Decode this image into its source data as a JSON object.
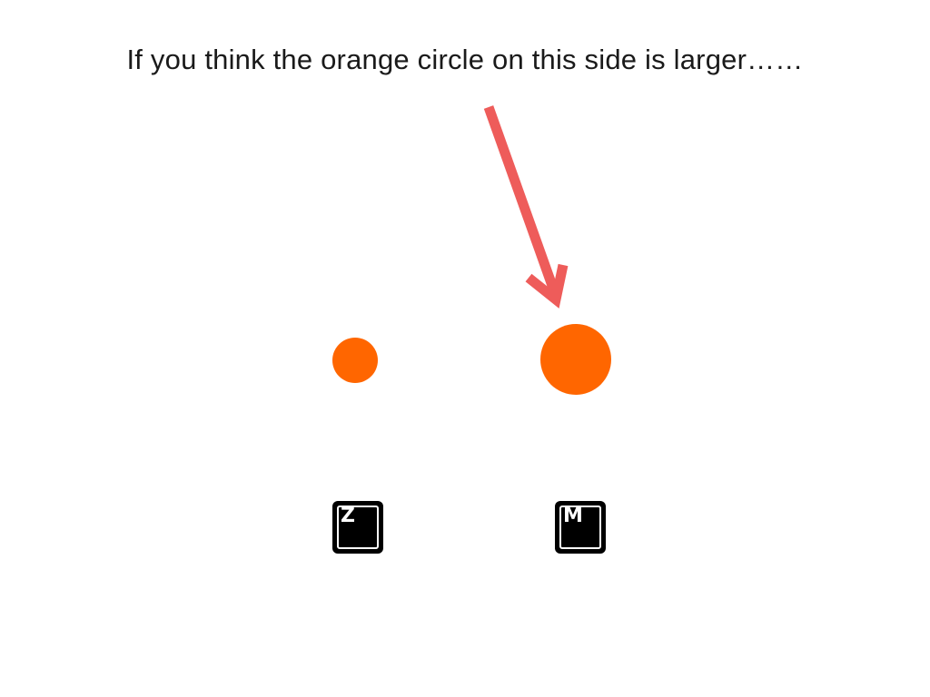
{
  "instruction_text": "If you think the orange circle on this side is larger……",
  "colors": {
    "circle": "#ff6600",
    "arrow": "#ee5c5a",
    "key_bg": "#000000",
    "key_fg": "#ffffff",
    "text": "#1a1a1a"
  },
  "stimuli": {
    "left_circle": {
      "relative_size": "small"
    },
    "right_circle": {
      "relative_size": "large"
    }
  },
  "keys": {
    "left": "Z",
    "right": "M"
  },
  "arrow": {
    "points_to": "right_circle"
  }
}
